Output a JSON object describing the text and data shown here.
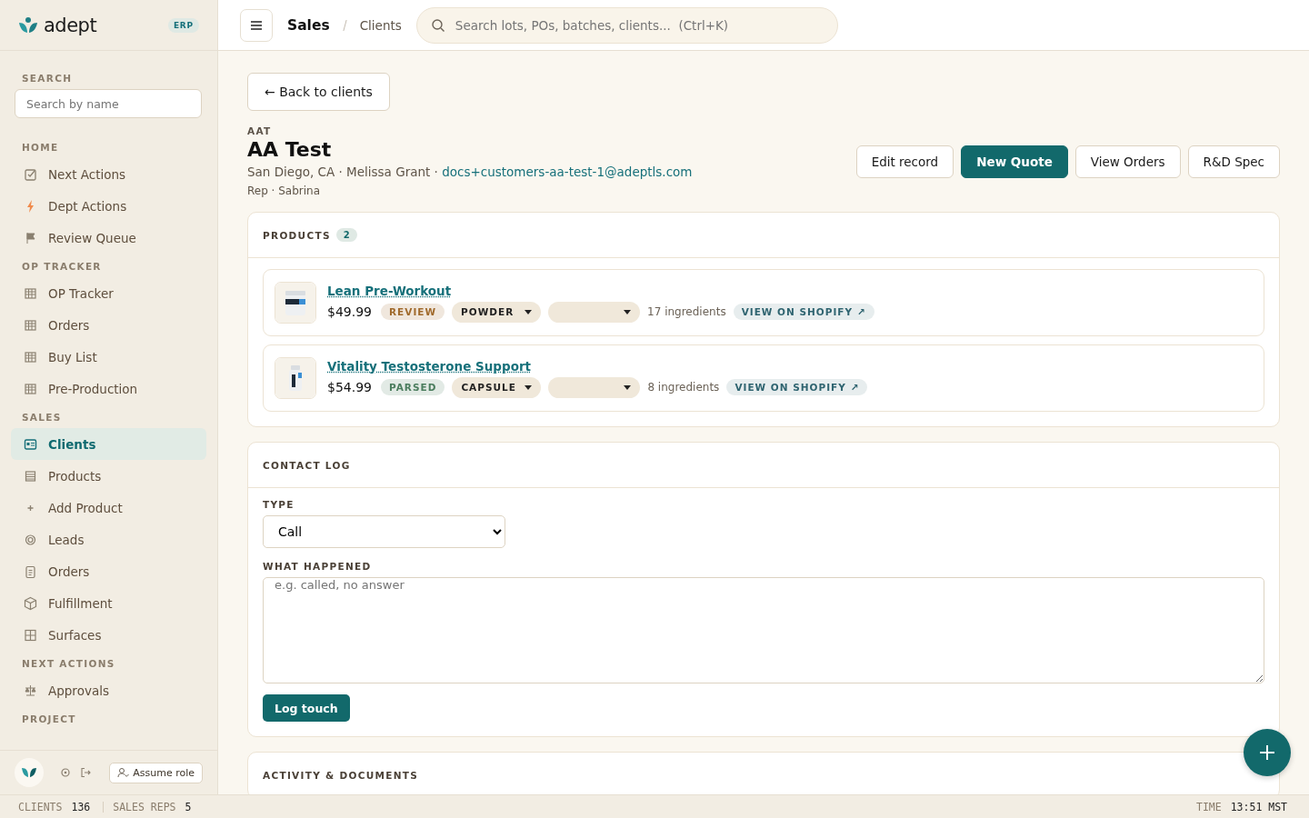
{
  "sidebar": {
    "brand": "adept",
    "brand_tag": "ERP",
    "search_label": "SEARCH",
    "search_placeholder": "Search by name",
    "sections": [
      {
        "title": "HOME",
        "items": [
          {
            "label": "Next Actions",
            "selected": false
          },
          {
            "label": "Dept Actions",
            "selected": false
          },
          {
            "label": "Review Queue",
            "selected": false
          }
        ]
      },
      {
        "title": "OP TRACKER",
        "items": [
          {
            "label": "OP Tracker",
            "selected": false
          },
          {
            "label": "Orders",
            "selected": false
          },
          {
            "label": "Buy List",
            "selected": false
          },
          {
            "label": "Pre-Production",
            "selected": false
          }
        ]
      },
      {
        "title": "SALES",
        "items": [
          {
            "label": "Clients",
            "selected": true
          },
          {
            "label": "Products",
            "selected": false
          },
          {
            "label": "Add Product",
            "selected": false
          },
          {
            "label": "Leads",
            "selected": false
          },
          {
            "label": "Orders",
            "selected": false
          },
          {
            "label": "Fulfillment",
            "selected": false
          },
          {
            "label": "Surfaces",
            "selected": false
          }
        ]
      },
      {
        "title": "NEXT ACTIONS",
        "items": [
          {
            "label": "Approvals",
            "selected": false
          }
        ]
      },
      {
        "title": "PROJECT"
      }
    ],
    "assume_role": "Assume role"
  },
  "topbar": {
    "breadcrumb": [
      "Sales",
      "Clients"
    ],
    "search_placeholder": "Search lots, POs, batches, clients...  (Ctrl+K)"
  },
  "back_button": "← Back to clients",
  "client": {
    "code": "AAT",
    "name": "AA Test",
    "details": "San Diego, CA · Melissa Grant · ",
    "email": "docs+customers-aa-test-1@adeptls.com",
    "rep": "Rep · Sabrina"
  },
  "actions": [
    {
      "label": "Edit record",
      "primary": false
    },
    {
      "label": "New Quote",
      "primary": true
    },
    {
      "label": "View Orders",
      "primary": false
    },
    {
      "label": "R&D Spec",
      "primary": false
    }
  ],
  "products": {
    "title": "PRODUCTS",
    "count": "2",
    "items": [
      {
        "name": "Lean Pre-Workout",
        "price": "$49.99",
        "status": "REVIEW",
        "color": "#a06a2c",
        "form": "POWDER",
        "ingredients": "17 ingredients",
        "link": "VIEW ON SHOPIFY ↗"
      },
      {
        "name": "Vitality Testosterone Support",
        "price": "$54.99",
        "status": "PARSED",
        "color": "#4b7d5e",
        "form": "CAPSULE",
        "ingredients": "8 ingredients",
        "link": "VIEW ON SHOPIFY ↗"
      }
    ]
  },
  "contact_log": {
    "title": "CONTACT LOG",
    "type_label": "TYPE",
    "type_value": "Call",
    "what_label": "WHAT HAPPENED",
    "what_placeholder": "e.g. called, no answer",
    "submit": "Log touch"
  },
  "activity": {
    "title": "ACTIVITY & DOCUMENTS"
  },
  "status_bar": {
    "left": [
      {
        "label": "CLIENTS",
        "value": "136"
      },
      {
        "label": "SALES REPS",
        "value": "5"
      }
    ],
    "right": {
      "label": "TIME",
      "value": "13:51 MST"
    }
  }
}
